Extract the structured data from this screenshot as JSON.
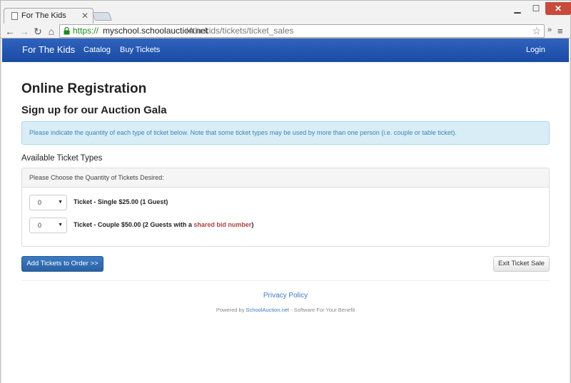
{
  "browser": {
    "tab_title": "For The Kids",
    "url_scheme": "https://",
    "url_host": "myschool.schoolauction.net",
    "url_path": "/4thekids/tickets/ticket_sales"
  },
  "navbar": {
    "brand": "For The Kids",
    "links": [
      "Catalog",
      "Buy Tickets"
    ],
    "login": "Login"
  },
  "page": {
    "title": "Online Registration",
    "subtitle": "Sign up for our Auction Gala",
    "alert": "Please indicate the quantity of each type of ticket below. Note that some ticket types may be used by more than one person (i.e. couple or table ticket).",
    "section_heading": "Available Ticket Types",
    "panel_heading": "Please Choose the Quantity of Tickets Desired:"
  },
  "tickets": [
    {
      "qty": "0",
      "label": "Ticket - Single $25.00 (1 Guest)"
    },
    {
      "qty": "0",
      "label_prefix": "Ticket - Couple $50.00 (2 Guests with a ",
      "label_link": "shared bid number",
      "label_suffix": ")"
    }
  ],
  "buttons": {
    "add": "Add Tickets to Order >>",
    "exit": "Exit Ticket Sale"
  },
  "footer": {
    "privacy": "Privacy Policy",
    "powered_prefix": "Powered by ",
    "powered_link": "SchoolAuction.net",
    "powered_suffix": " - Software For Your Benefit"
  },
  "colors": {
    "navbar": "#1a4ba3",
    "primary_button": "#2a61a3",
    "alert_bg": "#d9edf7",
    "alert_text": "#3a87ad",
    "link": "#3b7bc4",
    "shared_link": "#a94442"
  }
}
